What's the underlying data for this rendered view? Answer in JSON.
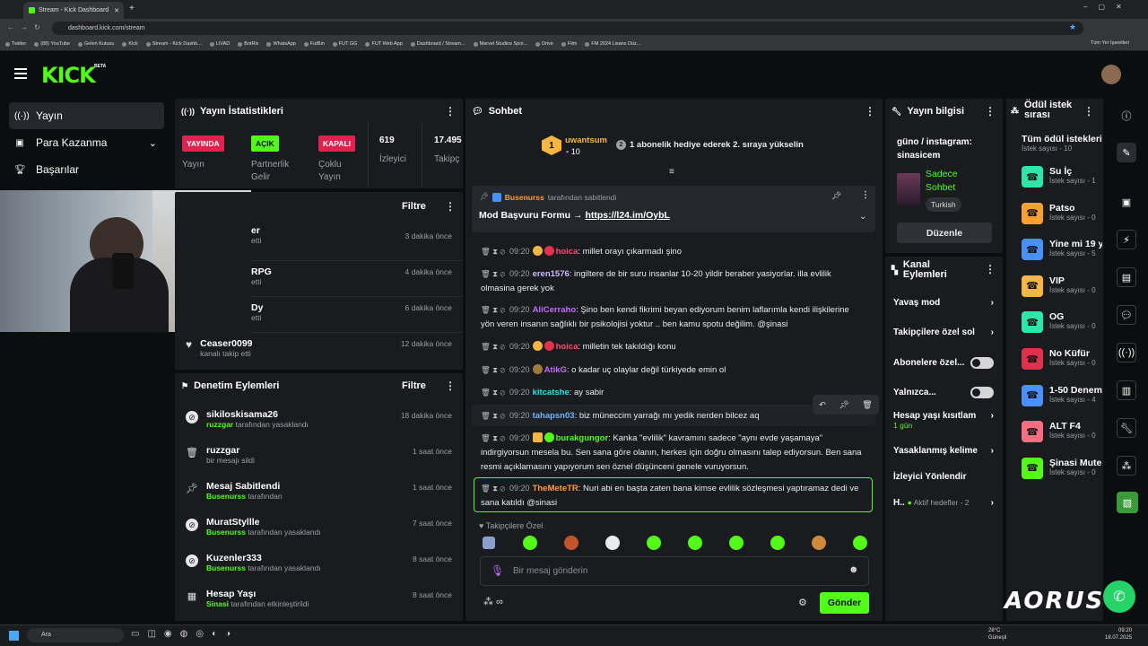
{
  "browser": {
    "tab_title": "Stream - Kick Dashboard",
    "url": "dashboard.kick.com/stream",
    "bookmarks": [
      "Twitter",
      "(88) YouTube",
      "Gelen Kutusu",
      "Kick",
      "Stream - Kick Dashb...",
      "LIVAD",
      "BotRix",
      "WhatsApp",
      "FutBin",
      "FUT GG",
      "FUT Web App",
      "Dashboard / Stream...",
      "Marvel Studios Spoi...",
      "Drive",
      "Film",
      "FM 2024 Lisans Düz..."
    ],
    "all_bookmarks": "Tüm Yer İşaretleri"
  },
  "brand": {
    "logo": "KICK",
    "beta": "BETA",
    "accent": "#53fc18"
  },
  "nav": [
    {
      "label": "Yayın"
    },
    {
      "label": "Para Kazanma"
    },
    {
      "label": "Başarılar"
    }
  ],
  "stats": {
    "title": "Yayın İstatistikleri",
    "live_badge": "YAYINDA",
    "live_label": "Yayın",
    "open_badge": "AÇIK",
    "open_label": "Partnerlik Gelir",
    "closed_badge": "KAPALI",
    "closed_label": "Çoklu Yayın",
    "viewers": "619",
    "viewers_label": "İzleyici",
    "followers": "17.495",
    "followers_label": "Takipç"
  },
  "activity": {
    "filter": "Filtre",
    "items": [
      {
        "user": "er",
        "sub": "etti",
        "time": "3 dakika önce"
      },
      {
        "user": "RPG",
        "sub": "etti",
        "time": "4 dakika önce"
      },
      {
        "user": "Dy",
        "sub": "etti",
        "time": "6 dakika önce"
      },
      {
        "user": "Ceaser0099",
        "sub": "kanalı takip etti",
        "time": "12 dakika önce"
      }
    ]
  },
  "moderation": {
    "title": "Denetim Eylemleri",
    "filter": "Filtre",
    "items": [
      {
        "user": "sikiloskisama26",
        "by": "ruzzgar",
        "action": "tarafından yasaklandı",
        "time": "18 dakika önce"
      },
      {
        "user": "ruzzgar",
        "by": "",
        "action": "bir mesajı sildi",
        "time": "1 saat önce"
      },
      {
        "user": "Mesaj Sabitlendi",
        "by": "Busenurss",
        "action": "tarafından",
        "time": "1 saat önce"
      },
      {
        "user": "MuratStyllle",
        "by": "Busenurss",
        "action": "tarafından yasaklandı",
        "time": "7 saat önce"
      },
      {
        "user": "Kuzenler333",
        "by": "Busenurss",
        "action": "tarafından yasaklandı",
        "time": "8 saat önce"
      },
      {
        "user": "Hesap Yaşı",
        "by": "Sinasi",
        "action": "tarafından etkinleştirildi",
        "time": "8 saat önce"
      }
    ]
  },
  "chat": {
    "title": "Sohbet",
    "top_user": "uwantsum",
    "top_count": "10",
    "top_rank": "1",
    "gift_num": "2",
    "gift_text": "1 abonelik hediye ederek 2. sıraya yükselin",
    "pinned_by": "Busenurss",
    "pinned_suffix": "tarafından sabitlendi",
    "pinned_text": "Mod Başvuru Formu → ",
    "pinned_link": "https://l24.im/OybL",
    "messages": [
      {
        "time": "09:20",
        "user": "hoica",
        "color": "#ff4d6d",
        "text": ": millet orayı çıkarmadı şino"
      },
      {
        "time": "09:20",
        "user": "eren1576",
        "color": "#c9b8ff",
        "text": ": ingiltere de bir suru insanlar 10-20 yildir beraber yasiyorlar. illa evlilik olmasina gerek yok"
      },
      {
        "time": "09:20",
        "user": "AliCerraho",
        "color": "#c26bff",
        "text": ": Şino ben kendi fikrimi beyan ediyorum benim laflarımla kendi ilişkilerine yön veren insanın sağlıklı bir psikolojisi yoktur .. ben kamu spotu değilim. @şinasi"
      },
      {
        "time": "09:20",
        "user": "hoica",
        "color": "#ff4d6d",
        "text": ": milletin tek takıldığı konu"
      },
      {
        "time": "09:20",
        "user": "AtikG",
        "color": "#c26bff",
        "text": ": o kadar uç olaylar değil türkiyede emin ol"
      },
      {
        "time": "09:20",
        "user": "kitcatshe",
        "color": "#2fe0e0",
        "text": ": ay sabir"
      },
      {
        "time": "09:20",
        "user": "tahapsn03",
        "color": "#6cb7ff",
        "text": ": biz müneccim yarrağı mı yedik nerden bilcez aq"
      },
      {
        "time": "09:20",
        "user": "burakgungor",
        "color": "#53fc18",
        "text": ": Kanka \"evlilik\" kavramını sadece \"aynı evde yaşamaya\" indirgiyorsun mesela bu. Sen sana göre olanın, herkes için doğru olmasını talep ediyorsun. Ben sana resmi açıklamasını yapıyorum sen öznel düşünceni genele vuruyorsun."
      },
      {
        "time": "09:20",
        "user": "TheMeteTR",
        "color": "#ff9c3a",
        "text": ": Nuri abi en başta zaten bana kimse evlilik sözleşmesi yaptıramaz dedi ve sana katıldı @sinasi"
      }
    ],
    "followers_only": "Takipçilere Özel",
    "placeholder": "Bir mesaj gönderin",
    "send": "Gönder"
  },
  "stream_info": {
    "title": "Yayın bilgisi",
    "stream_title": "güno / instagram: sinasicem",
    "category": "Sadece Sohbet",
    "lang": "Turkish",
    "edit": "Düzenle"
  },
  "channel": {
    "title": "Kanal Eylemleri",
    "items": [
      "Yavaş mod",
      "Takipçilere özel sol",
      "Abonelere özel...",
      "Yalnızca...",
      "Hesap yaşı kısıtlam",
      "Yasaklanmış kelime",
      "İzleyici Yönlendir",
      "H.."
    ],
    "age_sub": "1 gün",
    "goals": "Aktif hedefler - 2"
  },
  "rewards": {
    "title": "Ödül istek sırası",
    "all": "Tüm ödül istekleri",
    "all_sub": "İstek sayısı - 10",
    "items": [
      {
        "name": "Su İç",
        "sub": "İstek sayısı - 1",
        "color": "#2ee6a8"
      },
      {
        "name": "Patso",
        "sub": "İstek sayısı - 0",
        "color": "#ff9f2f"
      },
      {
        "name": "Yine mi 19 y",
        "sub": "İstek sayısı - 5",
        "color": "#4a90ff"
      },
      {
        "name": "VIP",
        "sub": "İstek sayısı - 0",
        "color": "#f5b642"
      },
      {
        "name": "OG",
        "sub": "İstek sayısı - 0",
        "color": "#2ee6a8"
      },
      {
        "name": "No Küfür",
        "sub": "İstek sayısı - 0",
        "color": "#e0314d"
      },
      {
        "name": "1-50 Denem",
        "sub": "İstek sayısı - 4",
        "color": "#4a90ff"
      },
      {
        "name": "ALT F4",
        "sub": "İstek sayısı - 0",
        "color": "#ff6b81"
      },
      {
        "name": "Şinasi Mute",
        "sub": "İstek sayısı - 0",
        "color": "#53fc18"
      }
    ]
  },
  "taskbar": {
    "search": "Ara",
    "weather": "28°C",
    "weather_sub": "Güneşli",
    "time": "09:20",
    "date": "18.07.2025"
  },
  "watermark": "AORUS"
}
